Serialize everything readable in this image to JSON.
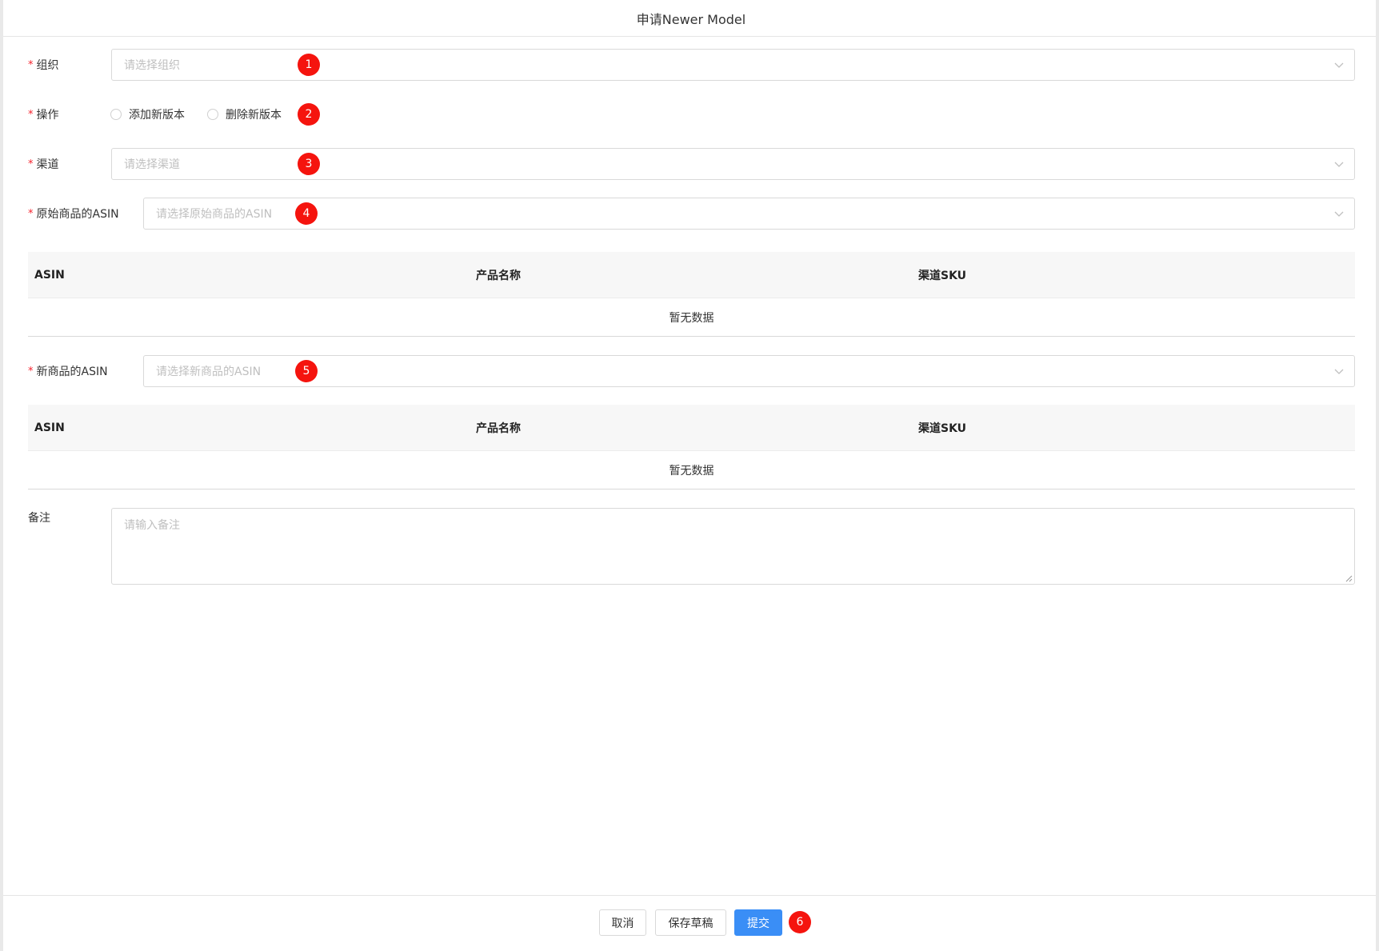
{
  "dialog": {
    "title": "申请Newer Model"
  },
  "form": {
    "org": {
      "label": "组织",
      "placeholder": "请选择组织",
      "badge": "1"
    },
    "operation": {
      "label": "操作",
      "options": [
        "添加新版本",
        "删除新版本"
      ],
      "badge": "2"
    },
    "channel": {
      "label": "渠道",
      "placeholder": "请选择渠道",
      "badge": "3"
    },
    "original_asin": {
      "label": "原始商品的ASIN",
      "placeholder": "请选择原始商品的ASIN",
      "badge": "4"
    },
    "original_table": {
      "columns": [
        "ASIN",
        "产品名称",
        "渠道SKU"
      ],
      "empty_text": "暂无数据"
    },
    "new_asin": {
      "label": "新商品的ASIN",
      "placeholder": "请选择新商品的ASIN",
      "badge": "5"
    },
    "new_table": {
      "columns": [
        "ASIN",
        "产品名称",
        "渠道SKU"
      ],
      "empty_text": "暂无数据"
    },
    "remark": {
      "label": "备注",
      "placeholder": "请输入备注"
    },
    "required_mark": "*"
  },
  "footer": {
    "cancel_label": "取消",
    "save_draft_label": "保存草稿",
    "submit_label": "提交",
    "badge": "6"
  },
  "colors": {
    "primary": "#3a8ef6",
    "badge": "#f5140e",
    "required": "#f5222d"
  }
}
